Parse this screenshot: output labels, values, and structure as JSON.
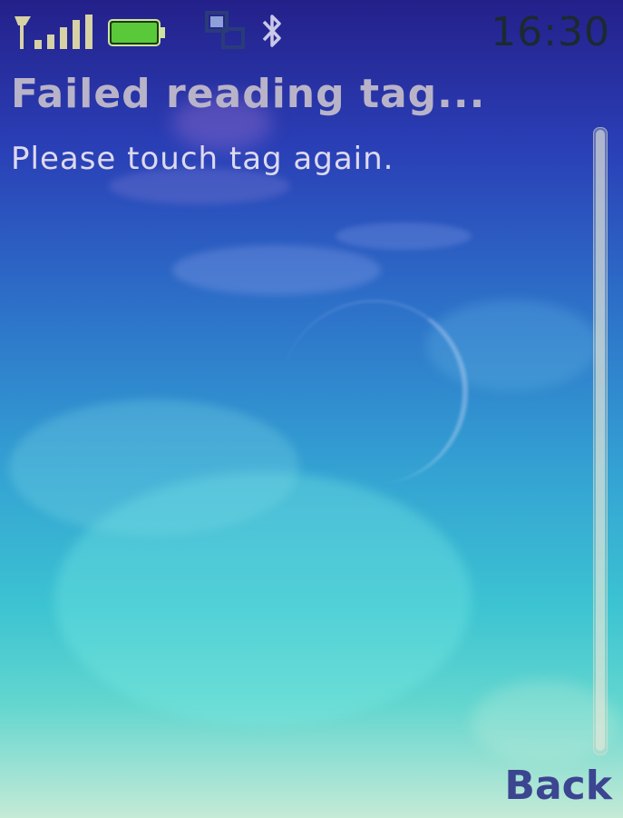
{
  "status_bar": {
    "time": "16:30",
    "signal_icon": "signal-strength-icon",
    "battery_icon": "battery-icon",
    "network_icon": "packet-data-icon",
    "bluetooth_icon": "bluetooth-icon",
    "battery_color": "#59c93a"
  },
  "dialog": {
    "title": "Failed reading tag...",
    "message": "Please touch tag again."
  },
  "softkeys": {
    "right": "Back"
  }
}
